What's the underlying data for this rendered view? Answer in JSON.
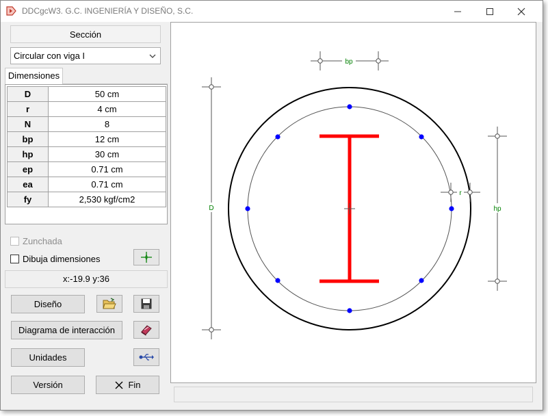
{
  "window": {
    "title": "DDCgcW3. G.C. INGENIERÍA Y DISEÑO, S.C."
  },
  "left_panel": {
    "section_label": "Sección",
    "section_type": "Circular con viga I",
    "tab_label": "Dimensiones",
    "params": [
      {
        "key": "D",
        "value": "50 cm"
      },
      {
        "key": "r",
        "value": "4 cm"
      },
      {
        "key": "N",
        "value": "8"
      },
      {
        "key": "bp",
        "value": "12 cm"
      },
      {
        "key": "hp",
        "value": "30 cm"
      },
      {
        "key": "ep",
        "value": "0.71 cm"
      },
      {
        "key": "ea",
        "value": "0.71 cm"
      },
      {
        "key": "fy",
        "value": "2,530 kgf/cm2"
      }
    ],
    "zunchada_label": "Zunchada",
    "dibuja_label": "Dibuja dimensiones",
    "coords": "x:-19.9 y:36",
    "buttons": {
      "diseno": "Diseño",
      "diagrama": "Diagrama de interacción",
      "unidades": "Unidades",
      "version": "Versión",
      "fin": "Fin"
    }
  },
  "drawing": {
    "labels": {
      "bp": "bp",
      "hp": "hp",
      "D": "D",
      "r": "r"
    },
    "colors": {
      "dimension_text": "#008000",
      "steel_section": "#ff0000",
      "rebar": "#0000ff"
    }
  }
}
